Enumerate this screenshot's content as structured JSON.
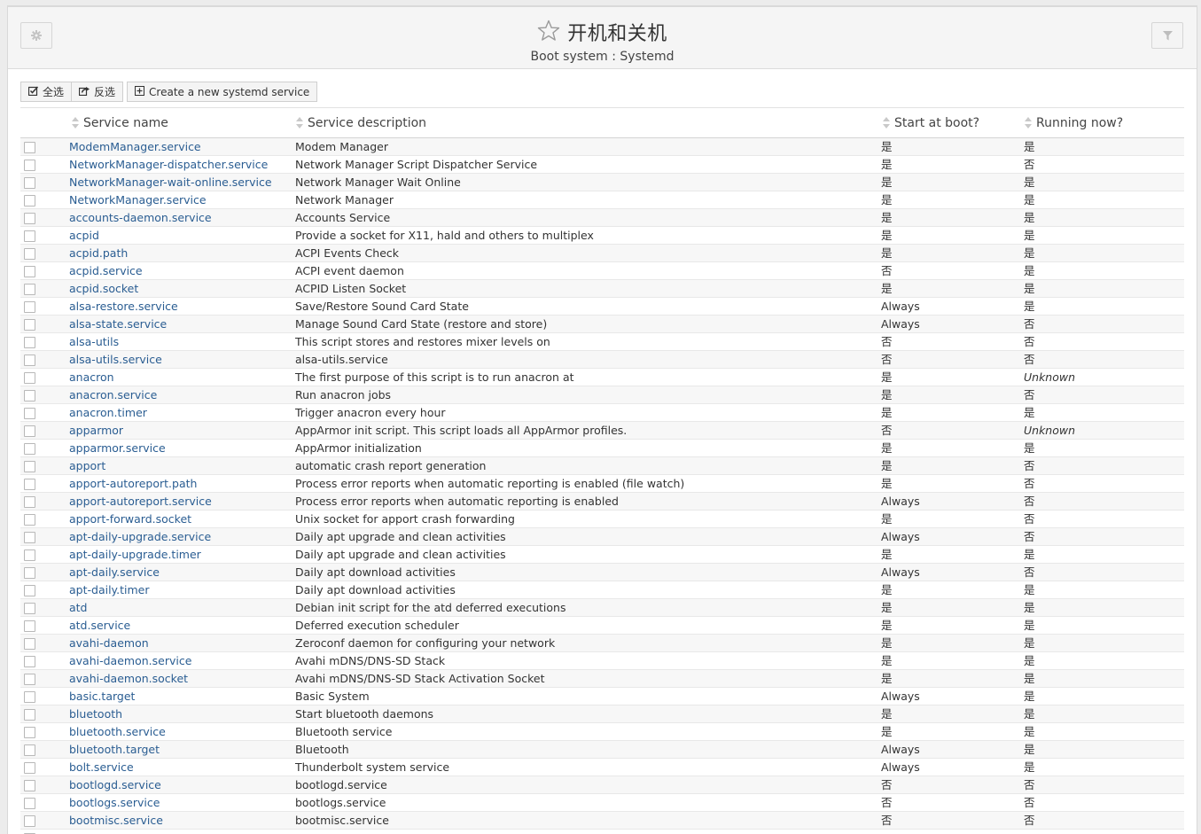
{
  "header": {
    "title": "开机和关机",
    "subtitle": "Boot system : Systemd",
    "settings_icon": "gear-icon",
    "filter_icon": "filter-icon",
    "star_icon": "star-icon"
  },
  "toolbar": {
    "select_all_label": "全选",
    "invert_label": "反选",
    "create_label": "Create a new systemd service"
  },
  "columns": {
    "name": "Service name",
    "description": "Service description",
    "boot": "Start at boot?",
    "running": "Running now?"
  },
  "colors": {
    "link": "#2a5d92",
    "negative": "#c9302c"
  },
  "rows": [
    {
      "name": "ModemManager.service",
      "desc": "Modem Manager",
      "boot": "是",
      "run": "是"
    },
    {
      "name": "NetworkManager-dispatcher.service",
      "desc": "Network Manager Script Dispatcher Service",
      "boot": "是",
      "run": "否"
    },
    {
      "name": "NetworkManager-wait-online.service",
      "desc": "Network Manager Wait Online",
      "boot": "是",
      "run": "是"
    },
    {
      "name": "NetworkManager.service",
      "desc": "Network Manager",
      "boot": "是",
      "run": "是"
    },
    {
      "name": "accounts-daemon.service",
      "desc": "Accounts Service",
      "boot": "是",
      "run": "是"
    },
    {
      "name": "acpid",
      "desc": "Provide a socket for X11, hald and others to multiplex",
      "boot": "是",
      "run": "是"
    },
    {
      "name": "acpid.path",
      "desc": "ACPI Events Check",
      "boot": "是",
      "run": "是"
    },
    {
      "name": "acpid.service",
      "desc": "ACPI event daemon",
      "boot": "否",
      "run": "是"
    },
    {
      "name": "acpid.socket",
      "desc": "ACPID Listen Socket",
      "boot": "是",
      "run": "是"
    },
    {
      "name": "alsa-restore.service",
      "desc": "Save/Restore Sound Card State",
      "boot": "Always",
      "run": "是"
    },
    {
      "name": "alsa-state.service",
      "desc": "Manage Sound Card State (restore and store)",
      "boot": "Always",
      "run": "否"
    },
    {
      "name": "alsa-utils",
      "desc": "This script stores and restores mixer levels on",
      "boot": "否",
      "run": "否"
    },
    {
      "name": "alsa-utils.service",
      "desc": "alsa-utils.service",
      "boot": "否",
      "run": "否"
    },
    {
      "name": "anacron",
      "desc": "The first purpose of this script is to run anacron at",
      "boot": "是",
      "run": "Unknown"
    },
    {
      "name": "anacron.service",
      "desc": "Run anacron jobs",
      "boot": "是",
      "run": "否"
    },
    {
      "name": "anacron.timer",
      "desc": "Trigger anacron every hour",
      "boot": "是",
      "run": "是"
    },
    {
      "name": "apparmor",
      "desc": "AppArmor init script. This script loads all AppArmor profiles.",
      "boot": "否",
      "run": "Unknown"
    },
    {
      "name": "apparmor.service",
      "desc": "AppArmor initialization",
      "boot": "是",
      "run": "是"
    },
    {
      "name": "apport",
      "desc": "automatic crash report generation",
      "boot": "是",
      "run": "否"
    },
    {
      "name": "apport-autoreport.path",
      "desc": "Process error reports when automatic reporting is enabled (file watch)",
      "boot": "是",
      "run": "否"
    },
    {
      "name": "apport-autoreport.service",
      "desc": "Process error reports when automatic reporting is enabled",
      "boot": "Always",
      "run": "否"
    },
    {
      "name": "apport-forward.socket",
      "desc": "Unix socket for apport crash forwarding",
      "boot": "是",
      "run": "否"
    },
    {
      "name": "apt-daily-upgrade.service",
      "desc": "Daily apt upgrade and clean activities",
      "boot": "Always",
      "run": "否"
    },
    {
      "name": "apt-daily-upgrade.timer",
      "desc": "Daily apt upgrade and clean activities",
      "boot": "是",
      "run": "是"
    },
    {
      "name": "apt-daily.service",
      "desc": "Daily apt download activities",
      "boot": "Always",
      "run": "否"
    },
    {
      "name": "apt-daily.timer",
      "desc": "Daily apt download activities",
      "boot": "是",
      "run": "是"
    },
    {
      "name": "atd",
      "desc": "Debian init script for the atd deferred executions",
      "boot": "是",
      "run": "是"
    },
    {
      "name": "atd.service",
      "desc": "Deferred execution scheduler",
      "boot": "是",
      "run": "是"
    },
    {
      "name": "avahi-daemon",
      "desc": "Zeroconf daemon for configuring your network",
      "boot": "是",
      "run": "是"
    },
    {
      "name": "avahi-daemon.service",
      "desc": "Avahi mDNS/DNS-SD Stack",
      "boot": "是",
      "run": "是"
    },
    {
      "name": "avahi-daemon.socket",
      "desc": "Avahi mDNS/DNS-SD Stack Activation Socket",
      "boot": "是",
      "run": "是"
    },
    {
      "name": "basic.target",
      "desc": "Basic System",
      "boot": "Always",
      "run": "是"
    },
    {
      "name": "bluetooth",
      "desc": "Start bluetooth daemons",
      "boot": "是",
      "run": "是"
    },
    {
      "name": "bluetooth.service",
      "desc": "Bluetooth service",
      "boot": "是",
      "run": "是"
    },
    {
      "name": "bluetooth.target",
      "desc": "Bluetooth",
      "boot": "Always",
      "run": "是"
    },
    {
      "name": "bolt.service",
      "desc": "Thunderbolt system service",
      "boot": "Always",
      "run": "是"
    },
    {
      "name": "bootlogd.service",
      "desc": "bootlogd.service",
      "boot": "否",
      "run": "否"
    },
    {
      "name": "bootlogs.service",
      "desc": "bootlogs.service",
      "boot": "否",
      "run": "否"
    },
    {
      "name": "bootmisc.service",
      "desc": "bootmisc.service",
      "boot": "否",
      "run": "否"
    },
    {
      "name": "",
      "desc": "",
      "boot": "",
      "run": ""
    }
  ]
}
